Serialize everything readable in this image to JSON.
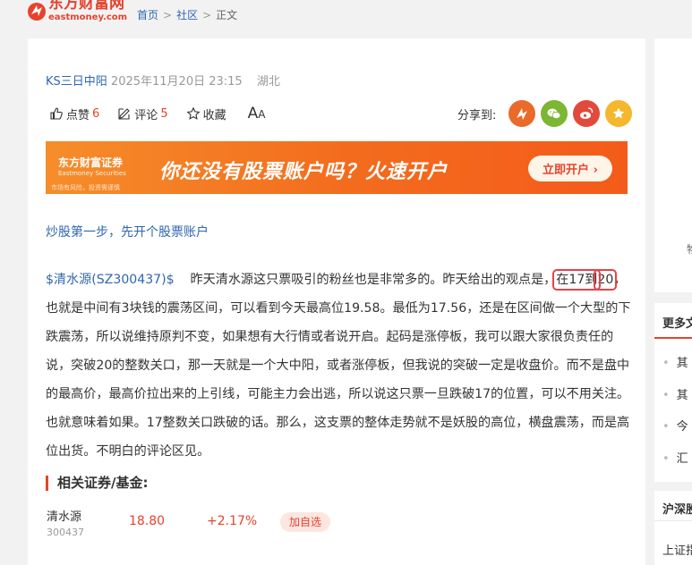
{
  "header": {
    "logo_cn": "东方财富网",
    "logo_en": "eastmoney.com",
    "breadcrumb": [
      "首页",
      "社区",
      "正文"
    ]
  },
  "post": {
    "author": "KS三日中阳",
    "datetime": "2025年11月20日 23:15",
    "location": "湖北"
  },
  "actions": {
    "like_label": "点赞",
    "like_count": "6",
    "comment_label": "评论",
    "comment_count": "5",
    "favorite_label": "收藏",
    "font_big": "A",
    "font_small": "A",
    "share_label": "分享到:"
  },
  "share_icons": [
    "weibo-icon",
    "wechat-icon",
    "sina-weibo-icon",
    "star-icon"
  ],
  "banner": {
    "brand": "东方财富证券",
    "brand_en": "Eastmoney Securities",
    "slogan": "你还没有股票账户吗？火速开户",
    "cta": "立即开户 ›",
    "note": "市场有风险，投资需谨慎"
  },
  "promo_link": "炒股第一步，先开个股票账户",
  "article": {
    "stock_link": "$清水源(SZ300437)$",
    "p1": "昨天清水源这只票吸引的粉丝也是非常多的。昨天给出的观点是，",
    "highlight1": "在17到",
    "highlight2": "20",
    "p2": "，也就是中间有3块钱的震荡区间，可以看到今天最高位19.58。最低为17.56，还是在区间做一个大型的下跌震荡，所以说维持原判不变，如果想有大行情或者说开启。起码是涨停板，我可以跟大家很负责任的说，突破20的整数关口，那一天就是一个大中阳，或者涨停板，但我说的突破一定是收盘价。而不是盘中的最高价，最高价拉出来的上引线，可能主力会出逃，所以说这只票一旦跌破17的位置，可以不用关注。也就意味着如果。17整数关口跌破的话。那么，这支票的整体走势就不是妖股的高位，横盘震荡，而是高位出货。不明白的评论区见。"
  },
  "related": {
    "title": "相关证券/基金:",
    "name": "清水源",
    "code": "300437",
    "price": "18.80",
    "change": "+2.17%",
    "add_label": "加自选"
  },
  "sidebar": {
    "cut_text": "物",
    "more_title": "更多文",
    "items": [
      "其",
      "其",
      "今",
      "汇"
    ],
    "market_title": "沪深股",
    "market_sub": "上证指"
  },
  "colors": {
    "brand_red": "#e5432d",
    "link_blue": "#2f66b3",
    "highlight_box": "#e5434b"
  }
}
